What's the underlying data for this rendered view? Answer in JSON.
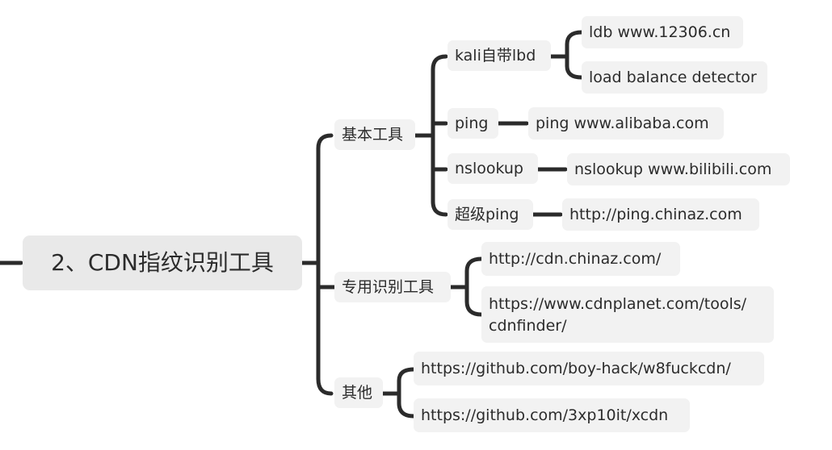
{
  "colors": {
    "line": "#2b2b2b",
    "node_bg": "#f2f2f2",
    "root_bg": "#e9e9e9",
    "text": "#2b2b2b"
  },
  "root": {
    "label": "2、CDN指纹识别工具"
  },
  "categories": [
    {
      "label": "基本工具",
      "children": [
        {
          "label": "kali自带lbd",
          "children": [
            "ldb www.12306.cn",
            "load balance detector"
          ]
        },
        {
          "label": "ping",
          "children": [
            "ping www.alibaba.com"
          ]
        },
        {
          "label": "nslookup",
          "children": [
            "nslookup www.bilibili.com"
          ]
        },
        {
          "label": "超级ping",
          "children": [
            "http://ping.chinaz.com"
          ]
        }
      ]
    },
    {
      "label": "专用识别工具",
      "children": [
        {
          "label": "http://cdn.chinaz.com/"
        },
        {
          "label": "https://www.cdnplanet.com/tools/\ncdnfinder/"
        }
      ]
    },
    {
      "label": "其他",
      "children": [
        {
          "label": "https://github.com/boy-hack/w8fuckcdn/"
        },
        {
          "label": "https://github.com/3xp10it/xcdn"
        }
      ]
    }
  ]
}
